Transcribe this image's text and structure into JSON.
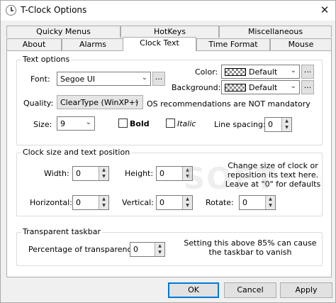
{
  "window": {
    "title": "T-Clock Options",
    "close_glyph": "✕"
  },
  "tabs_row1": [
    {
      "label": "Quicky Menus"
    },
    {
      "label": "HotKeys"
    },
    {
      "label": "Miscellaneous"
    }
  ],
  "tabs_row2": [
    {
      "label": "About"
    },
    {
      "label": "Alarms"
    },
    {
      "label": "Clock Text",
      "active": true
    },
    {
      "label": "Time Format"
    },
    {
      "label": "Mouse"
    }
  ],
  "text_options": {
    "title": "Text options",
    "font_label": "Font:",
    "font_value": "Segoe UI",
    "color_label": "Color:",
    "color_value": "Default",
    "background_label": "Background:",
    "background_value": "Default",
    "quality_label": "Quality:",
    "quality_value": "ClearType (WinXP+)",
    "quality_note": "OS recommendations are NOT mandatory",
    "size_label": "Size:",
    "size_value": "9",
    "bold_label": "Bold",
    "bold_checked": false,
    "italic_label": "Italic",
    "italic_checked": false,
    "line_spacing_label": "Line spacing:",
    "line_spacing_value": "0",
    "ellipsis": "..."
  },
  "clock_size": {
    "title": "Clock size and text position",
    "width_label": "Width:",
    "width_value": "0",
    "height_label": "Height:",
    "height_value": "0",
    "horizontal_label": "Horizontal:",
    "horizontal_value": "0",
    "vertical_label": "Vertical:",
    "vertical_value": "0",
    "rotate_label": "Rotate:",
    "rotate_value": "0",
    "hint_line1": "Change size of clock or",
    "hint_line2": "reposition its text here.",
    "hint_line3": "Leave at \"0\" for defaults"
  },
  "transparent": {
    "title": "Transparent taskbar",
    "percent_label": "Percentage of transparency:",
    "percent_value": "0",
    "hint_line1": "Setting this above 85% can cause",
    "hint_line2": "the taskbar to vanish"
  },
  "buttons": {
    "ok": "OK",
    "cancel": "Cancel",
    "apply": "Apply"
  },
  "watermark": "SOFT",
  "icons": {
    "dropdown": "chevron-down-icon",
    "spin_up": "▲",
    "spin_down": "▼"
  }
}
